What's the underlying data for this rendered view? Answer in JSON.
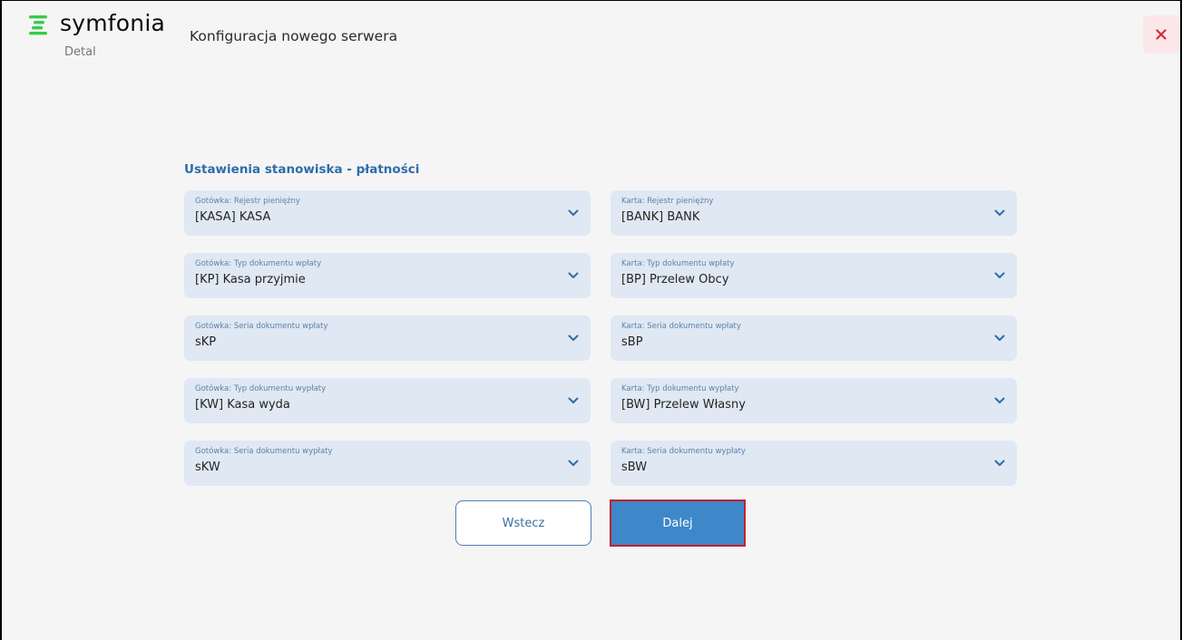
{
  "app": {
    "brand": "symfonia",
    "module": "Detal",
    "title": "Konfiguracja nowego serwera",
    "brand_color": "#35cc4b",
    "accent_color": "#3e87c8",
    "close_icon": "close-icon"
  },
  "section": {
    "title": "Ustawienia stanowiska - płatności"
  },
  "fields": [
    {
      "label": "Gotówka: Rejestr pieniężny",
      "value": "[KASA] KASA"
    },
    {
      "label": "Karta: Rejestr pieniężny",
      "value": "[BANK] BANK"
    },
    {
      "label": "Gotówka: Typ dokumentu wpłaty",
      "value": "[KP] Kasa przyjmie"
    },
    {
      "label": "Karta: Typ dokumentu wpłaty",
      "value": "[BP] Przelew Obcy"
    },
    {
      "label": "Gotówka: Seria dokumentu wpłaty",
      "value": "sKP"
    },
    {
      "label": "Karta: Seria dokumentu wpłaty",
      "value": "sBP"
    },
    {
      "label": "Gotówka: Typ dokumentu wypłaty",
      "value": "[KW] Kasa wyda"
    },
    {
      "label": "Karta: Typ dokumentu wypłaty",
      "value": "[BW] Przelew Własny"
    },
    {
      "label": "Gotówka: Seria dokumentu wypłaty",
      "value": "sKW"
    },
    {
      "label": "Karta: Seria dokumentu wypłaty",
      "value": "sBW"
    }
  ],
  "buttons": {
    "back": "Wstecz",
    "next": "Dalej"
  }
}
